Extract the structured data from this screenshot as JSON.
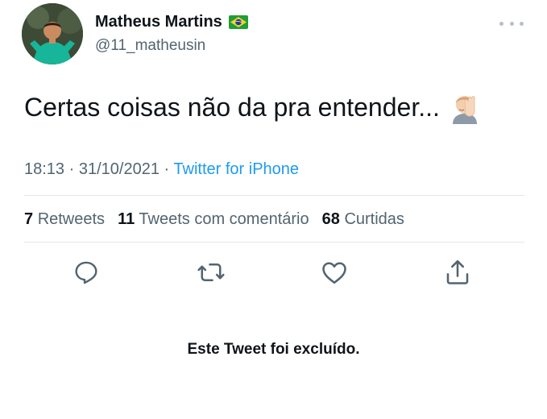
{
  "author": {
    "name": "Matheus Martins",
    "handle": "@11_matheusin",
    "flag_icon": "brazil-flag-icon",
    "avatar_icon": "profile-photo"
  },
  "tweet": {
    "text": "Certas coisas não da pra entender...",
    "emoji": "face-palm-emoji",
    "time": "18:13",
    "separator": "·",
    "date": "31/10/2021",
    "source": "Twitter for iPhone"
  },
  "stats": [
    {
      "count": "7",
      "label": "Retweets"
    },
    {
      "count": "11",
      "label": "Tweets com comentário"
    },
    {
      "count": "68",
      "label": "Curtidas"
    }
  ],
  "actions": [
    "reply-icon",
    "retweet-icon",
    "like-icon",
    "share-icon"
  ],
  "notice": "Este Tweet foi excluído.",
  "colors": {
    "link": "#1d9bf0",
    "secondary_text": "#536471",
    "primary_text": "#0f1419",
    "divider": "#e2e6ea"
  }
}
